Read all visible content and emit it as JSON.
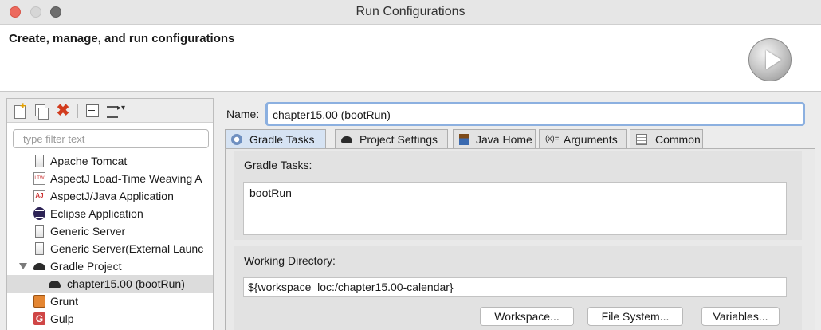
{
  "window": {
    "title": "Run Configurations"
  },
  "header": {
    "title": "Create, manage, and run configurations"
  },
  "sidebar": {
    "filter_placeholder": "type filter text",
    "items": [
      {
        "label": "Apache Tomcat",
        "icon": "server-icon"
      },
      {
        "label": "AspectJ Load-Time Weaving A",
        "icon": "ltw-icon"
      },
      {
        "label": "AspectJ/Java Application",
        "icon": "aspectj-icon"
      },
      {
        "label": "Eclipse Application",
        "icon": "eclipse-icon"
      },
      {
        "label": "Generic Server",
        "icon": "server-icon"
      },
      {
        "label": "Generic Server(External Launc",
        "icon": "server-icon"
      },
      {
        "label": "Gradle Project",
        "icon": "gradle-icon",
        "expanded": true
      },
      {
        "label": "chapter15.00 (bootRun)",
        "icon": "gradle-icon",
        "selected": true
      },
      {
        "label": "Grunt",
        "icon": "grunt-icon"
      },
      {
        "label": "Gulp",
        "icon": "gulp-icon"
      }
    ]
  },
  "form": {
    "name_label": "Name:",
    "name_value": "chapter15.00 (bootRun)",
    "tabs": [
      {
        "label": "Gradle Tasks",
        "active": true
      },
      {
        "label": "Project Settings"
      },
      {
        "label": "Java Home"
      },
      {
        "label": "Arguments",
        "icon_text": "(x)="
      },
      {
        "label": "Common"
      }
    ],
    "tasks_label": "Gradle Tasks:",
    "tasks_value": "bootRun",
    "workdir_label": "Working Directory:",
    "workdir_value": "${workspace_loc:/chapter15.00-calendar}",
    "buttons": {
      "workspace": "Workspace...",
      "file_system": "File System...",
      "variables": "Variables..."
    }
  },
  "colors": {
    "close": "#ec6a5e",
    "active_tab": "#d6e3f3",
    "focus": "#8cb0e0",
    "delete": "#d23c1e"
  }
}
